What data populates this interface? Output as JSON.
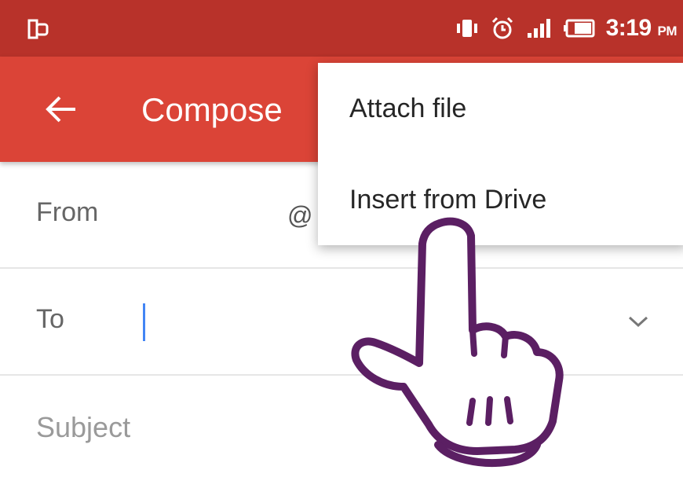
{
  "status_bar": {
    "time": "3:19",
    "ampm": "PM",
    "icons": [
      "sim-switch-icon",
      "vibrate-icon",
      "alarm-icon",
      "signal-icon",
      "battery-icon"
    ]
  },
  "toolbar": {
    "title": "Compose",
    "back_icon": "arrow-back-icon"
  },
  "fields": {
    "from_label": "From",
    "from_value": "@",
    "to_label": "To",
    "subject_placeholder": "Subject"
  },
  "menu": {
    "items": [
      {
        "label": "Attach file"
      },
      {
        "label": "Insert from Drive"
      }
    ]
  },
  "colors": {
    "status_bar": "#b8322a",
    "toolbar": "#db4437",
    "accent": "#4285f4",
    "hand_outline": "#5b1f63"
  }
}
